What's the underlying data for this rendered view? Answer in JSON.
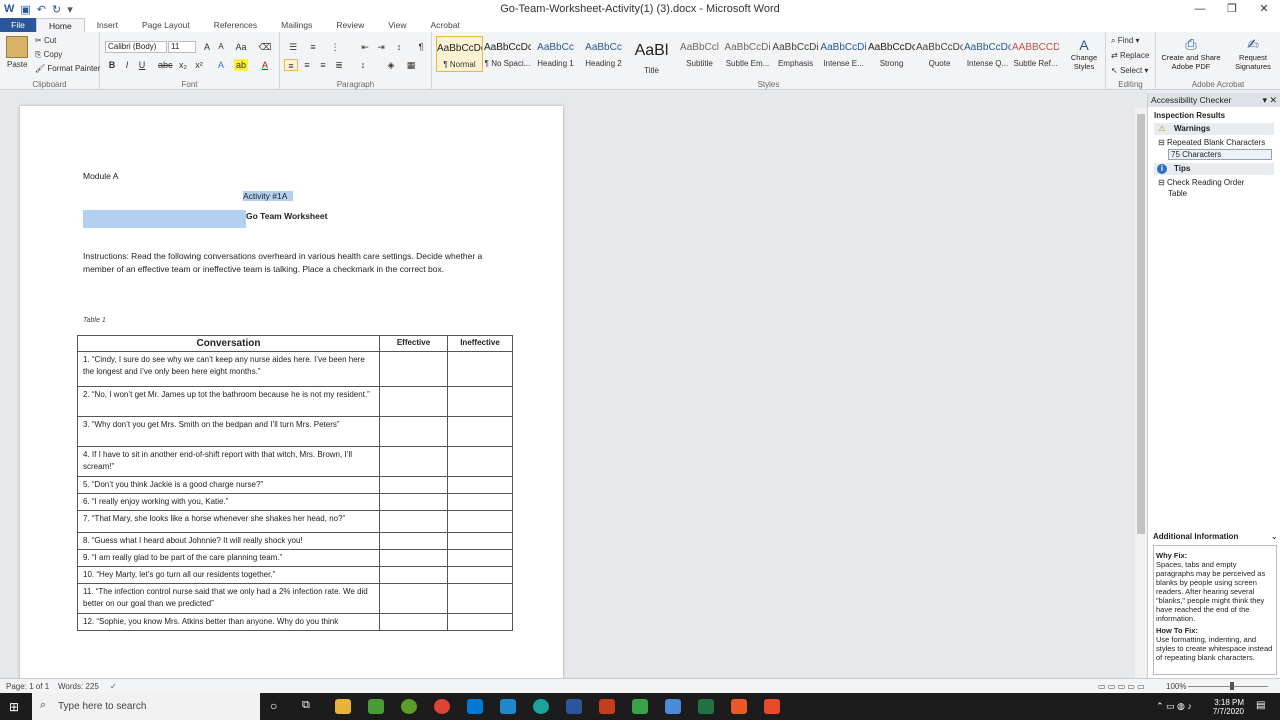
{
  "window": {
    "title": "Go-Team-Worksheet-Activity(1) (3).docx - Microsoft Word"
  },
  "tabs": [
    "File",
    "Home",
    "Insert",
    "Page Layout",
    "References",
    "Mailings",
    "Review",
    "View",
    "Acrobat"
  ],
  "ribbon": {
    "clipboard": {
      "label": "Clipboard",
      "paste": "Paste",
      "cut": "Cut",
      "copy": "Copy",
      "format_painter": "Format Painter"
    },
    "font": {
      "label": "Font",
      "name": "Calibri (Body)",
      "size": "11"
    },
    "paragraph": {
      "label": "Paragraph"
    },
    "styles": {
      "label": "Styles",
      "items": [
        {
          "preview": "AaBbCcDc",
          "name": "¶ Normal"
        },
        {
          "preview": "AaBbCcDc",
          "name": "¶ No Spaci..."
        },
        {
          "preview": "AaBbCc",
          "name": "Heading 1"
        },
        {
          "preview": "AaBbCc",
          "name": "Heading 2"
        },
        {
          "preview": "AaBl",
          "name": "Title"
        },
        {
          "preview": "AaBbCcl",
          "name": "Subtitle"
        },
        {
          "preview": "AaBbCcDi",
          "name": "Subtle Em..."
        },
        {
          "preview": "AaBbCcDi",
          "name": "Emphasis"
        },
        {
          "preview": "AaBbCcDi",
          "name": "Intense E..."
        },
        {
          "preview": "AaBbCcDc",
          "name": "Strong"
        },
        {
          "preview": "AaBbCcDc",
          "name": "Quote"
        },
        {
          "preview": "AaBbCcDc",
          "name": "Intense Q..."
        },
        {
          "preview": "AABBCCDC",
          "name": "Subtle Ref..."
        }
      ],
      "change_styles": "Change Styles"
    },
    "editing": {
      "label": "Editing",
      "find": "Find",
      "replace": "Replace",
      "select": "Select"
    },
    "acrobat": {
      "label": "Adobe Acrobat",
      "create": "Create and Share Adobe PDF",
      "request": "Request Signatures"
    }
  },
  "document": {
    "module": "Module A",
    "activity": "Activity #1A",
    "heading": "Go Team Worksheet",
    "instructions": "Instructions:  Read the following conversations overheard in various health care settings.  Decide whether a member of an effective team or ineffective team is talking.  Place a checkmark in the correct box.",
    "caption": "Table 1",
    "table": {
      "headers": [
        "Conversation",
        "Effective",
        "Ineffective"
      ],
      "rows": [
        "1. “Cindy, I sure do see why we can’t keep any nurse aides here. I’ve been here the longest and I’ve only been here eight months.”",
        "2. “No, I won’t get Mr. James up tot the bathroom because he is not my resident.”",
        "3. “Why don’t you get Mrs. Smith on the bedpan and I’ll turn Mrs. Peters”",
        "4.  If I have to sit in another end-of-shift report with that witch, Mrs. Brown, I’ll scream!”",
        "5. “Don’t you think Jackie is a good charge nurse?”",
        "6. “I really enjoy working with you, Katie.”",
        "7. “That Mary, she looks like a horse whenever she shakes her head, no?”",
        "8. “Guess what I heard about Johnnie?  It will really shock you!",
        "9. “I am really glad to be part of the care planning team.”",
        "10. “Hey Marty, let’s go turn all our residents together.”",
        "11. “The infection control nurse said that we only had a 2% infection rate.  We did better on our goal than we predicted”",
        "12. “Sophie, you know Mrs. Atkins better than anyone.  Why do you think"
      ]
    }
  },
  "accessibility": {
    "title": "Accessibility Checker",
    "results": "Inspection Results",
    "warnings": "Warnings",
    "warning_item": "Repeated Blank Characters",
    "warning_sub": "75 Characters",
    "tips": "Tips",
    "tip_item": "Check Reading Order",
    "tip_sub": "Table",
    "additional": "Additional Information",
    "why_fix_label": "Why Fix:",
    "why_fix": "Spaces, tabs and empty paragraphs may be perceived as blanks by people using screen readers. After hearing several \"blanks,\" people might think they have reached the end of the information.",
    "how_fix_label": "How To Fix:",
    "how_fix": "Use formatting, indenting, and styles to create whitespace instead of repeating blank characters."
  },
  "status": {
    "page": "Page: 1 of 1",
    "words": "Words: 225",
    "zoom": "100%"
  },
  "taskbar": {
    "search": "Type here to search",
    "time": "3:18 PM",
    "date": "7/7/2020"
  }
}
